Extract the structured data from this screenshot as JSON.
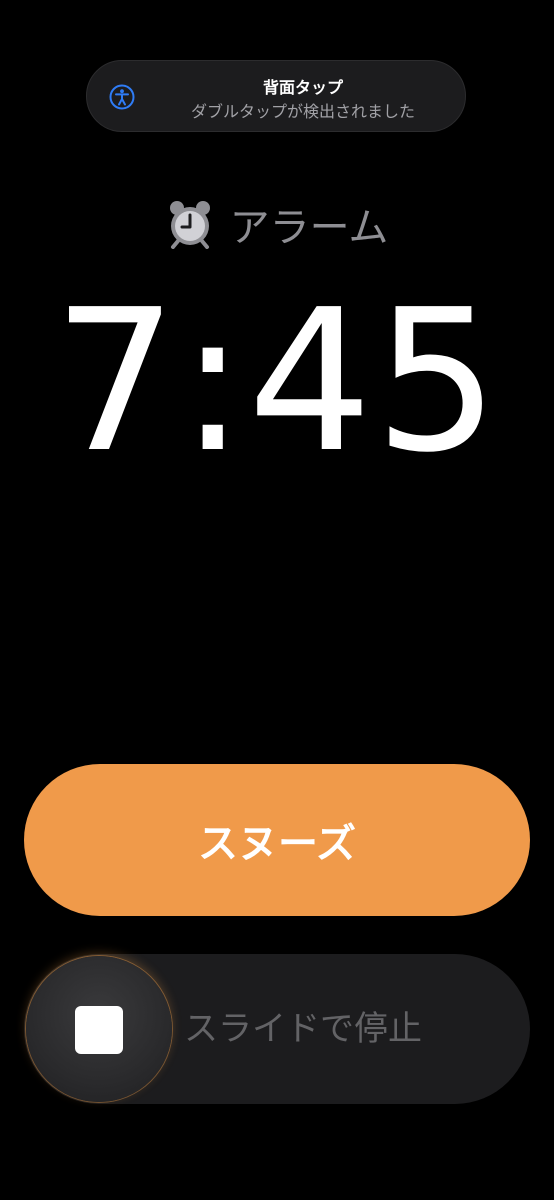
{
  "banner": {
    "title": "背面タップ",
    "subtitle": "ダブルタップが検出されました",
    "icon": "accessibility-icon",
    "icon_color": "#2f7cf6"
  },
  "alarm": {
    "label": "アラーム",
    "icon": "alarm-clock-icon",
    "time": "7:45"
  },
  "snooze": {
    "label": "スヌーズ",
    "color": "#f09a4a"
  },
  "stop_slider": {
    "label": "スライドで停止",
    "icon": "stop-icon"
  }
}
